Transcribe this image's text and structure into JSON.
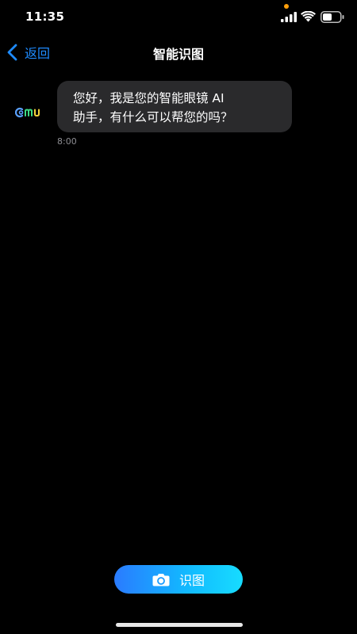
{
  "status_bar": {
    "time": "11:35",
    "icons": [
      "cellular-signal-icon",
      "wifi-icon",
      "battery-icon"
    ],
    "privacy_indicator_color": "#ff9f0a"
  },
  "nav": {
    "back_label": "返回",
    "title": "智能识图",
    "back_icon": "chevron-left-icon",
    "accent_color": "#1e8bff"
  },
  "chat": {
    "avatar_icon": "brand-logo-icon",
    "message": {
      "lines": [
        "您好，我是您的智能眼镜 AI",
        "助手，有什么可以帮您的吗？"
      ],
      "time": "8:00"
    }
  },
  "action": {
    "label": "识图",
    "icon": "camera-icon"
  },
  "colors": {
    "background": "#000000",
    "bubble": "#2a2a2c",
    "button_gradient_start": "#2a7bff",
    "button_gradient_end": "#17dcff"
  }
}
